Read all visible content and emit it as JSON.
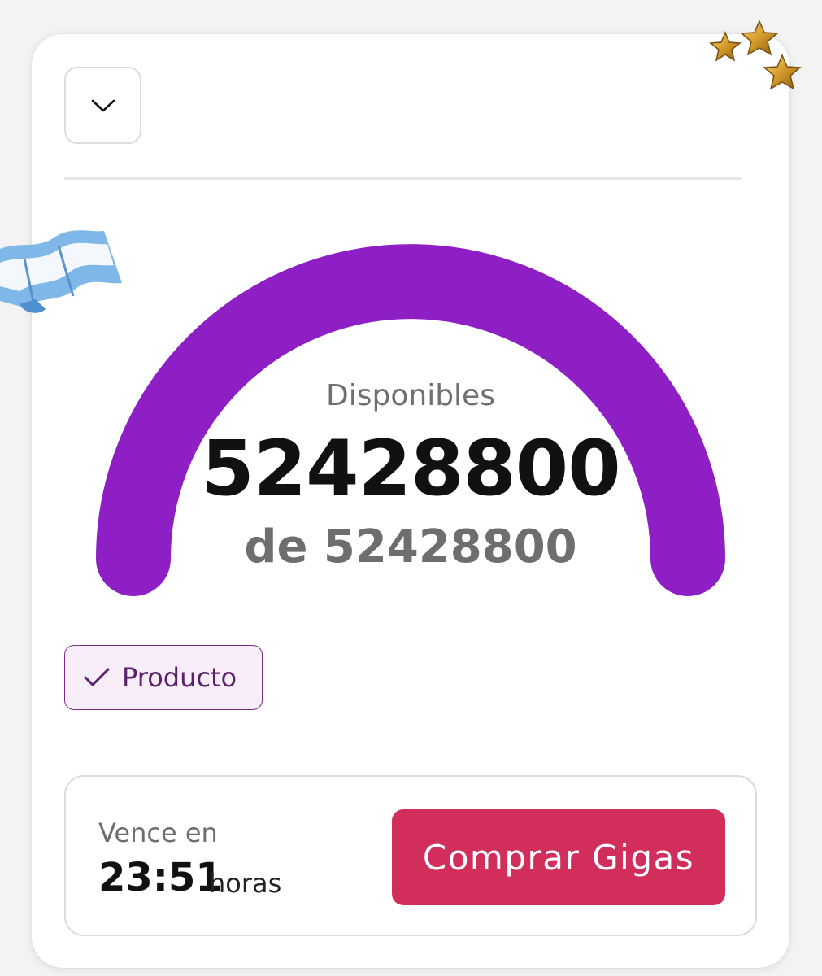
{
  "header": {
    "dropdown_icon": "chevron-down-icon"
  },
  "gauge": {
    "label": "Disponibles",
    "available": "52428800",
    "total_text": "de 52428800",
    "available_value": 52428800,
    "total_value": 52428800,
    "fill_fraction": 1.0,
    "color": "#8e1fc4"
  },
  "chip": {
    "icon": "check-icon",
    "label": "Producto",
    "border_color": "#7b2a86",
    "background_color": "#f8eefa"
  },
  "expiry": {
    "title": "Vence en",
    "time": "23:51",
    "unit": "horas"
  },
  "buy_button": {
    "label": "Comprar Gigas",
    "color": "#d22e5c"
  },
  "decorations": {
    "stars_icon": "stars-icon",
    "flag_icon": "argentina-flag-icon"
  }
}
